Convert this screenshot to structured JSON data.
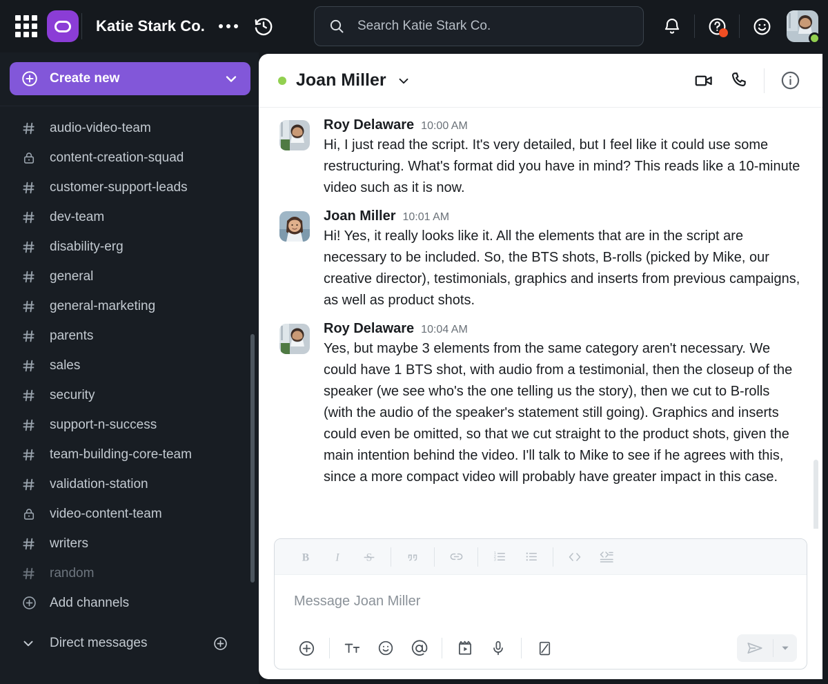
{
  "topbar": {
    "apps_icon": "grid-apps-icon",
    "logo_icon": "app-logo-icon",
    "workspace_name": "Katie Stark Co.",
    "more_icon": "more-options-icon",
    "history_icon": "history-clock-icon",
    "search": {
      "placeholder": "Search Katie Stark Co.",
      "icon": "search-icon"
    },
    "notifications_icon": "bell-icon",
    "help_icon": "help-question-icon",
    "emoji_status_icon": "smiley-icon",
    "avatar": "user-avatar",
    "status": "online"
  },
  "sidebar": {
    "create_new": {
      "label": "Create new",
      "plus_icon": "plus-circle-icon",
      "chevron_icon": "chevron-down-icon"
    },
    "channels": [
      {
        "label": "audio-video-team",
        "icon": "hash-icon",
        "muted": false
      },
      {
        "label": "content-creation-squad",
        "icon": "lock-icon",
        "muted": false
      },
      {
        "label": "customer-support-leads",
        "icon": "hash-icon",
        "muted": false
      },
      {
        "label": "dev-team",
        "icon": "hash-icon",
        "muted": false
      },
      {
        "label": "disability-erg",
        "icon": "hash-icon",
        "muted": false
      },
      {
        "label": "general",
        "icon": "hash-icon",
        "muted": false
      },
      {
        "label": "general-marketing",
        "icon": "hash-icon",
        "muted": false
      },
      {
        "label": "parents",
        "icon": "hash-icon",
        "muted": false
      },
      {
        "label": "sales",
        "icon": "hash-icon",
        "muted": false
      },
      {
        "label": "security",
        "icon": "hash-icon",
        "muted": false
      },
      {
        "label": "support-n-success",
        "icon": "hash-icon",
        "muted": false
      },
      {
        "label": "team-building-core-team",
        "icon": "hash-icon",
        "muted": false
      },
      {
        "label": "validation-station",
        "icon": "hash-icon",
        "muted": false
      },
      {
        "label": "video-content-team",
        "icon": "lock-icon",
        "muted": false
      },
      {
        "label": "writers",
        "icon": "hash-icon",
        "muted": false
      },
      {
        "label": "random",
        "icon": "hash-icon",
        "muted": true
      }
    ],
    "add_channels": {
      "label": "Add channels",
      "icon": "plus-circle-icon"
    },
    "direct_messages": {
      "label": "Direct messages",
      "chevron_icon": "chevron-down-icon",
      "add_icon": "plus-circle-icon"
    }
  },
  "chat": {
    "peer_name": "Joan Miller",
    "peer_status": "online",
    "caret_icon": "chevron-down-icon",
    "video_icon": "video-camera-icon",
    "call_icon": "phone-icon",
    "info_icon": "info-circle-icon",
    "messages": [
      {
        "author": "Roy Delaware",
        "time": "10:00 AM",
        "text": "Hi, I just read the script. It's very detailed, but I feel like it could use some restructuring. What's format did you have in mind? This reads like a 10-minute video such as it is now."
      },
      {
        "author": "Joan Miller",
        "time": "10:01 AM",
        "text": "Hi! Yes, it really looks like it. All the elements that are in the script are necessary to be included. So, the BTS shots, B-rolls (picked by Mike, our creative director), testimonials, graphics and inserts from previous campaigns, as well as product shots."
      },
      {
        "author": "Roy Delaware",
        "time": "10:04 AM",
        "text": "Yes, but maybe 3 elements from the same category aren't necessary. We could have 1 BTS shot, with audio from a testimonial, then the closeup of the speaker (we see who's the one telling us the story), then we cut to B-rolls (with the audio of the speaker's statement still going). Graphics and inserts could even be omitted, so that we cut straight to the product shots, given the main intention behind the video. I'll talk to Mike to see if he agrees with this, since a more compact video will probably have greater impact in this case."
      }
    ]
  },
  "composer": {
    "placeholder": "Message Joan Miller",
    "format_tools": [
      {
        "name": "bold-icon",
        "label": "B"
      },
      {
        "name": "italic-icon",
        "label": "I"
      },
      {
        "name": "strikethrough-icon",
        "label": "S"
      },
      {
        "name": "quote-icon",
        "label": "””"
      },
      {
        "name": "link-icon",
        "label": "⚭"
      },
      {
        "name": "ordered-list-icon",
        "label": "1."
      },
      {
        "name": "bullet-list-icon",
        "label": "•"
      },
      {
        "name": "code-icon",
        "label": "<>"
      },
      {
        "name": "code-block-icon",
        "label": "<>≡"
      }
    ],
    "action_tools": [
      {
        "name": "attach-plus-icon"
      },
      {
        "name": "text-format-icon"
      },
      {
        "name": "emoji-icon"
      },
      {
        "name": "mention-icon"
      },
      {
        "name": "video-clip-icon"
      },
      {
        "name": "microphone-icon"
      },
      {
        "name": "canvas-icon"
      }
    ],
    "send_icon": "send-paper-plane-icon",
    "send_caret_icon": "chevron-down-icon"
  },
  "colors": {
    "accent_purple": "#8257d9",
    "logo_purple": "#8b3dd6",
    "topbar_bg": "#15191e",
    "sidebar_bg": "#181d23",
    "status_green": "#92d050",
    "alert_orange": "#f04e23"
  }
}
